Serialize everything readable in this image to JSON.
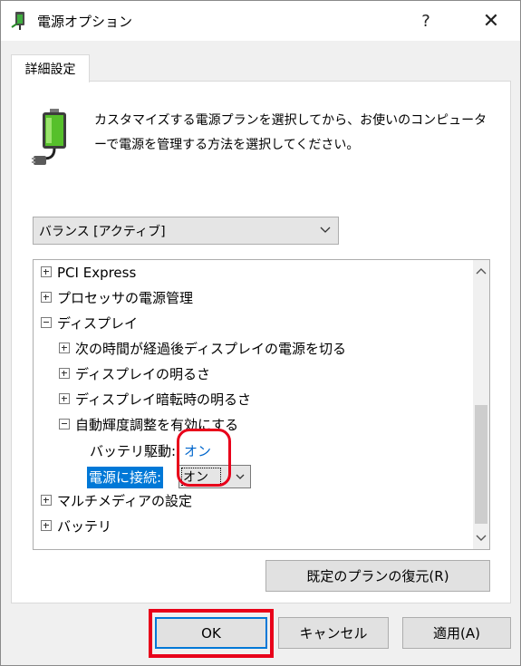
{
  "window": {
    "title": "電源オプション",
    "help_label": "?",
    "close_label": "✕"
  },
  "tab": {
    "label": "詳細設定"
  },
  "description": "カスタマイズする電源プランを選択してから、お使いのコンピューターで電源を管理する方法を選択してください。",
  "plan_select": {
    "value": "バランス [アクティブ]"
  },
  "tree": {
    "items": [
      {
        "label": "PCI Express",
        "expander": "+"
      },
      {
        "label": "プロセッサの電源管理",
        "expander": "+"
      },
      {
        "label": "ディスプレイ",
        "expander": "−"
      },
      {
        "label": "次の時間が経過後ディスプレイの電源を切る",
        "expander": "+"
      },
      {
        "label": "ディスプレイの明るさ",
        "expander": "+"
      },
      {
        "label": "ディスプレイ暗転時の明るさ",
        "expander": "+"
      },
      {
        "label": "自動輝度調整を有効にする",
        "expander": "−"
      },
      {
        "label": "マルチメディアの設定",
        "expander": "+"
      },
      {
        "label": "バッテリ",
        "expander": "+"
      }
    ],
    "battery_setting": {
      "label": "バッテリ駆動:",
      "value": "オン"
    },
    "plugged_setting": {
      "label": "電源に接続:",
      "value": "オン"
    }
  },
  "buttons": {
    "restore": "既定のプランの復元(R)",
    "ok": "OK",
    "cancel": "キャンセル",
    "apply": "適用(A)"
  },
  "colors": {
    "accent": "#0078d7",
    "link": "#0066cc",
    "highlight_annotation": "#e8001a"
  },
  "icons": {
    "title": "power-plug-icon",
    "battery": "battery-plug-icon"
  }
}
